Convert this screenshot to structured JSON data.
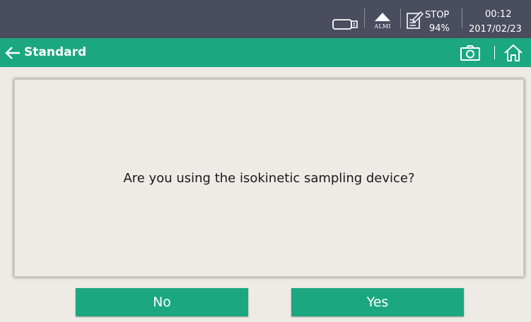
{
  "status_bar": {
    "alarm_label": "ALMI",
    "recording_status": "STOP",
    "battery_percent": "94%",
    "time": "00:12",
    "date": "2017/02/23",
    "icons": [
      "usb-storage-icon",
      "alarm-triangle-icon",
      "recording-edit-icon"
    ]
  },
  "title_bar": {
    "title": "Standard",
    "icons": [
      "back-arrow-icon",
      "camera-icon",
      "home-icon"
    ]
  },
  "dialog": {
    "question": "Are you using the isokinetic sampling device?"
  },
  "buttons": {
    "no_label": "No",
    "yes_label": "Yes"
  },
  "colors": {
    "status_bar_bg": "#4a4d5e",
    "accent_green": "#1ba77f",
    "background": "#eeebe6"
  }
}
